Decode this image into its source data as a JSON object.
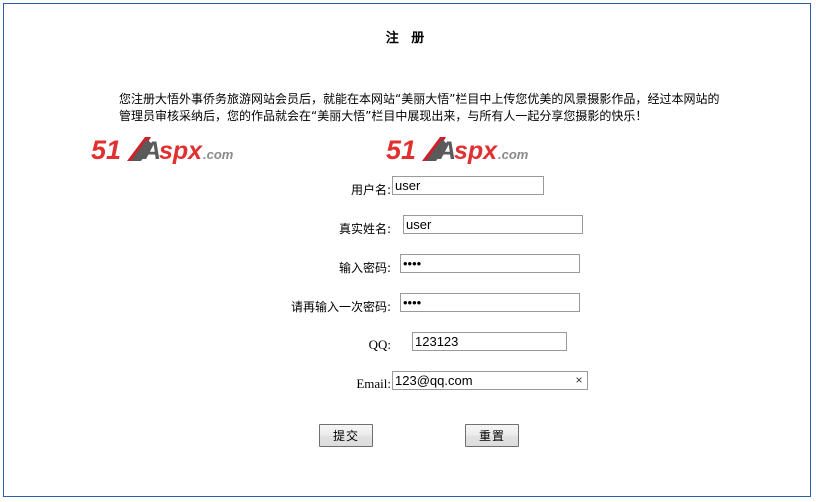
{
  "page": {
    "title": "注 册",
    "intro_lines": [
      "您注册大悟外事侨务旅游网站会员后，就能在本网站“美丽大悟”栏目中上传您优美的风景摄影作品，经过本网站的",
      "管理员审核采纳后，您的作品就会在“美丽大悟”栏目中展现出来，与所有人一起分享您摄影的快乐！"
    ]
  },
  "logos": [
    {
      "name": "51aspx-logo-left",
      "prefix": "51",
      "mid": "A",
      "suffix": "spx",
      "tld": ".com",
      "red": "#e03030",
      "gray": "#7a7a7a"
    },
    {
      "name": "51aspx-logo-right",
      "prefix": "51",
      "mid": "A",
      "suffix": "spx",
      "tld": ".com",
      "red": "#e03030",
      "gray": "#7a7a7a"
    }
  ],
  "form": {
    "fields": [
      {
        "key": "username",
        "label": "用户名:",
        "value": "user",
        "placeholder": "",
        "type": "text"
      },
      {
        "key": "realname",
        "label": "真实姓名:",
        "value": "user",
        "placeholder": "",
        "type": "text"
      },
      {
        "key": "password",
        "label": "输入密码:",
        "value": "1234",
        "placeholder": "",
        "type": "password"
      },
      {
        "key": "password2",
        "label": "请再输入一次密码:",
        "value": "1234",
        "placeholder": "",
        "type": "password"
      },
      {
        "key": "qq",
        "label": "QQ:",
        "value": "123123",
        "placeholder": "",
        "type": "text"
      },
      {
        "key": "email",
        "label": "Email:",
        "value": "123@qq.com",
        "placeholder": "",
        "type": "text"
      }
    ],
    "email_clear_icon": "×",
    "buttons": {
      "submit": "提交",
      "reset": "重置"
    }
  },
  "colors": {
    "frame_border": "#2a5caa",
    "input_border": "#999a9c",
    "button_border": "#707070",
    "logo_red": "#e03030",
    "logo_gray": "#7a7a7a"
  }
}
